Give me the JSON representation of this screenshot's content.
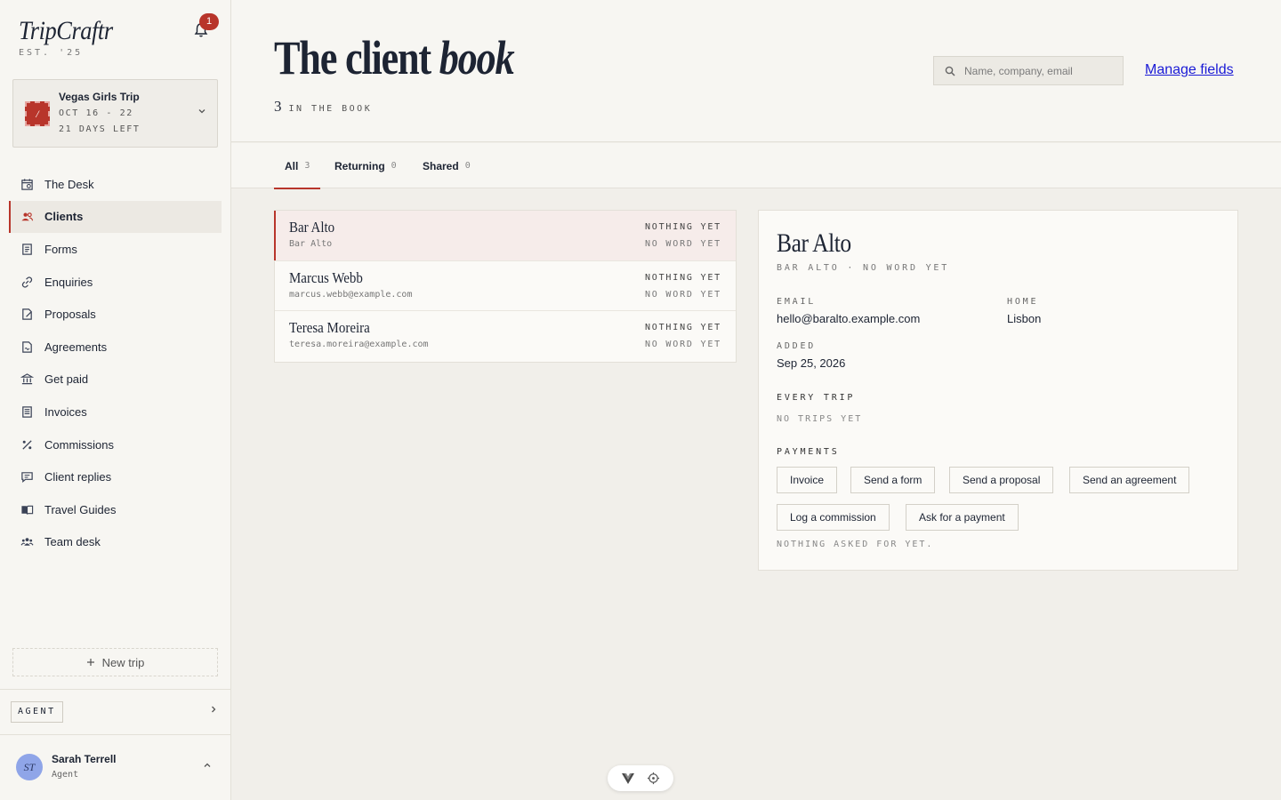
{
  "brand": {
    "name": "TripCraftr",
    "est": "EST. '25"
  },
  "notifications": {
    "count": "1"
  },
  "trip": {
    "title": "Vegas Girls Trip",
    "dates": "OCT 16 - 22",
    "days_left": "21 DAYS LEFT",
    "stamp": "/"
  },
  "nav": [
    {
      "label": "The Desk",
      "icon": "desk-calendar-icon"
    },
    {
      "label": "Clients",
      "icon": "users-icon",
      "active": true
    },
    {
      "label": "Forms",
      "icon": "form-icon"
    },
    {
      "label": "Enquiries",
      "icon": "link-icon"
    },
    {
      "label": "Proposals",
      "icon": "proposal-icon"
    },
    {
      "label": "Agreements",
      "icon": "agreement-icon"
    },
    {
      "label": "Get paid",
      "icon": "bank-icon"
    },
    {
      "label": "Invoices",
      "icon": "invoice-icon"
    },
    {
      "label": "Commissions",
      "icon": "percent-icon"
    },
    {
      "label": "Client replies",
      "icon": "chat-icon"
    },
    {
      "label": "Travel Guides",
      "icon": "book-icon"
    },
    {
      "label": "Team desk",
      "icon": "team-icon"
    }
  ],
  "sidebar_footer": {
    "new_trip": "New trip",
    "agent": "AGENT"
  },
  "user": {
    "initials": "ST",
    "name": "Sarah Terrell",
    "role": "Agent"
  },
  "header": {
    "title_plain": "The client ",
    "title_italic": "book",
    "count": "3",
    "count_label": "IN THE BOOK",
    "search_placeholder": "Name, company, email",
    "manage_fields": "Manage fields"
  },
  "tabs": [
    {
      "label": "All",
      "count": "3",
      "active": true
    },
    {
      "label": "Returning",
      "count": "0"
    },
    {
      "label": "Shared",
      "count": "0"
    }
  ],
  "clients": [
    {
      "name": "Bar Alto",
      "sub": "Bar Alto",
      "status": "NOTHING YET",
      "reply": "NO WORD YET",
      "selected": true
    },
    {
      "name": "Marcus Webb",
      "sub": "marcus.webb@example.com",
      "status": "NOTHING YET",
      "reply": "NO WORD YET"
    },
    {
      "name": "Teresa Moreira",
      "sub": "teresa.moreira@example.com",
      "status": "NOTHING YET",
      "reply": "NO WORD YET"
    }
  ],
  "detail": {
    "name": "Bar Alto",
    "subtitle": "BAR ALTO · NO WORD YET",
    "email_label": "EMAIL",
    "email": "hello@baralto.example.com",
    "home_label": "HOME",
    "home": "Lisbon",
    "added_label": "ADDED",
    "added": "Sep 25, 2026",
    "trips_label": "EVERY TRIP",
    "trips_empty": "NO TRIPS YET",
    "payments_label": "PAYMENTS",
    "actions": [
      "Invoice",
      "Send a form",
      "Send a proposal",
      "Send an agreement",
      "Log a commission",
      "Ask for a payment"
    ],
    "payments_empty": "NOTHING ASKED FOR YET."
  },
  "colors": {
    "accent": "#b8352b",
    "ink": "#1d2433",
    "link": "#1a1ad6",
    "paper": "#f7f6f2"
  }
}
